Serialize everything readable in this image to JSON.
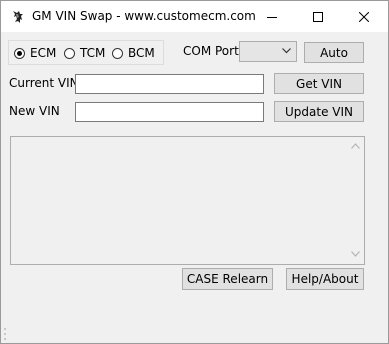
{
  "window": {
    "title": "GM VIN Swap - www.customecm.com",
    "icons": {
      "app": "app-icon",
      "minimize": "minimize-icon",
      "maximize": "maximize-icon",
      "close": "close-icon"
    }
  },
  "module": {
    "options": [
      {
        "label": "ECM",
        "selected": true
      },
      {
        "label": "TCM",
        "selected": false
      },
      {
        "label": "BCM",
        "selected": false
      }
    ]
  },
  "com_port": {
    "label": "COM Port",
    "value": "",
    "auto_label": "Auto"
  },
  "current_vin": {
    "label": "Current VIN",
    "value": "",
    "button": "Get VIN"
  },
  "new_vin": {
    "label": "New VIN",
    "value": "",
    "button": "Update VIN"
  },
  "log": {
    "value": ""
  },
  "footer": {
    "case_button": "CASE Relearn",
    "help_button": "Help/About"
  }
}
